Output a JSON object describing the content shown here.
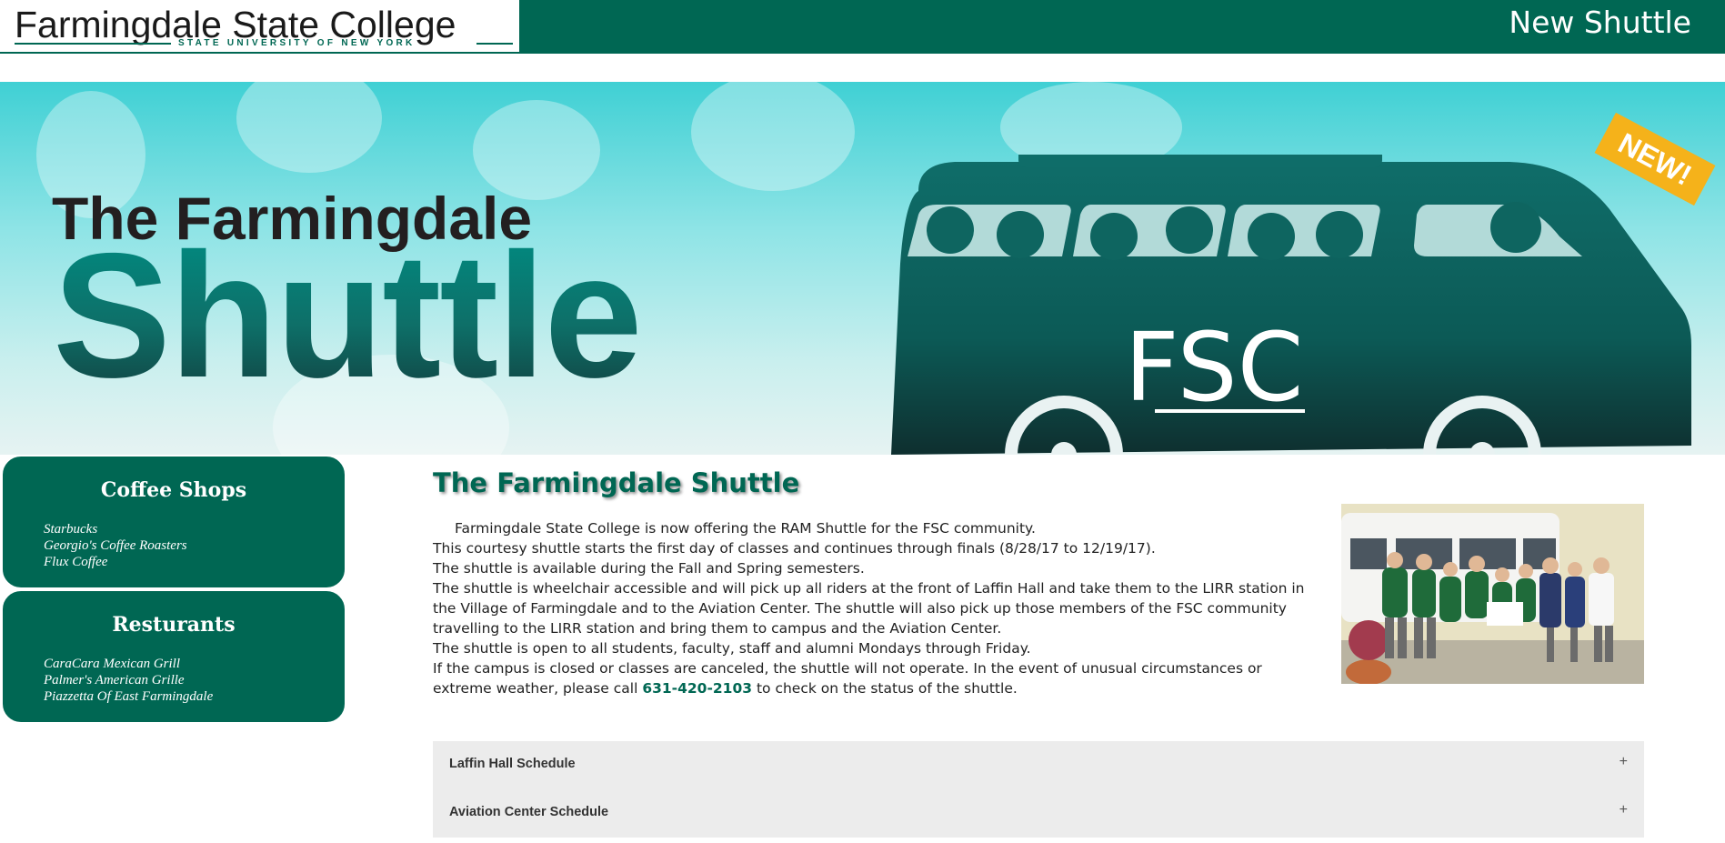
{
  "header": {
    "logo_title": "Farmingdale State College",
    "logo_subtitle": "STATE UNIVERSITY OF NEW YORK",
    "page_title": "New Shuttle"
  },
  "banner": {
    "line1": "The Farmingdale",
    "line2": "Shuttle",
    "bus_label": "FSC",
    "badge": "NEW!"
  },
  "sidebar": {
    "coffee": {
      "title": "Coffee Shops",
      "items": [
        "Starbucks",
        "Georgio's Coffee Roasters",
        "Flux Coffee"
      ]
    },
    "restaurants": {
      "title": "Resturants",
      "items": [
        "CaraCara Mexican Grill",
        "Palmer's American Grille",
        "Piazzetta Of East Farmingdale"
      ]
    }
  },
  "main": {
    "title": "The Farmingdale Shuttle",
    "paragraphs": [
      "Farmingdale State College is now offering the RAM Shuttle for the FSC community.",
      "This courtesy shuttle starts the first day of classes and continues through finals (8/28/17 to 12/19/17).",
      "The shuttle is available during the Fall and Spring semesters.",
      "The shuttle is wheelchair accessible and will pick up all riders at the front of Laffin Hall and take them to the LIRR station in",
      "the Village of Farmingdale and to the Aviation Center.  The shuttle will also pick up those members of the FSC community",
      "travelling to the LIRR station and bring them to campus and the Aviation Center.",
      "The shuttle is open to all students, faculty, staff and alumni Mondays through Friday.",
      "If the campus is closed or classes are canceled, the shuttle will not operate.  In the event of unusual circumstances or"
    ],
    "last_line_before": "extreme weather, please call ",
    "phone": "631-420-2103",
    "last_line_after": " to check on the status of the shuttle."
  },
  "accordion": [
    {
      "label": "Laffin Hall Schedule",
      "toggle": "+"
    },
    {
      "label": "Aviation Center Schedule",
      "toggle": "+"
    }
  ],
  "colors": {
    "brand_green": "#006753",
    "accordion_bg": "#ececec"
  }
}
